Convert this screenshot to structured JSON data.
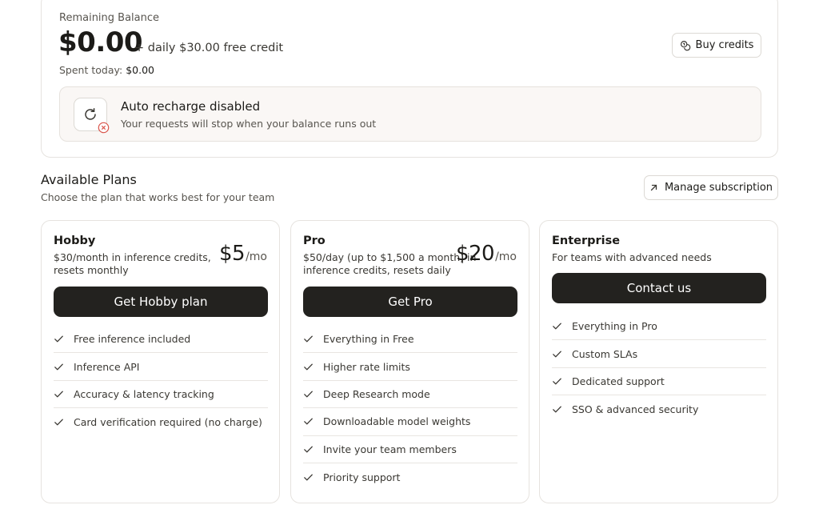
{
  "balance": {
    "label": "Remaining Balance",
    "amount": "$0.00",
    "free_credit": "+ daily $30.00 free credit",
    "spent_label": "Spent today:",
    "spent_value": "$0.00",
    "buy_label": "Buy credits"
  },
  "recharge": {
    "title": "Auto recharge disabled",
    "subtitle": "Your requests will stop when your balance runs out"
  },
  "plans_section": {
    "title": "Available Plans",
    "subtitle": "Choose the plan that works best for your team",
    "manage_label": "Manage subscription"
  },
  "plans": [
    {
      "name": "Hobby",
      "description": "$30/month in inference credits, resets monthly",
      "price": "$5",
      "unit": "/mo",
      "cta": "Get Hobby plan",
      "features": [
        "Free inference included",
        "Inference API",
        "Accuracy & latency tracking",
        "Card verification required (no charge)"
      ]
    },
    {
      "name": "Pro",
      "description": "$50/day (up to $1,500 a month) in inference credits, resets daily",
      "price": "$20",
      "unit": "/mo",
      "cta": "Get Pro",
      "features": [
        "Everything in Free",
        "Higher rate limits",
        "Deep Research mode",
        "Downloadable model weights",
        "Invite your team members",
        "Priority support"
      ]
    },
    {
      "name": "Enterprise",
      "description": "For teams with advanced needs",
      "cta": "Contact us",
      "features": [
        "Everything in Pro",
        "Custom SLAs",
        "Dedicated support",
        "SSO & advanced security"
      ]
    }
  ],
  "icons": {
    "buy": "coins-icon",
    "manage": "arrow-up-right-icon",
    "recharge": "refresh-icon",
    "recharge_status": "x-circle-icon",
    "feature": "check-icon"
  },
  "colors": {
    "cta_background": "#23221f",
    "error_accent": "#d9544a"
  }
}
